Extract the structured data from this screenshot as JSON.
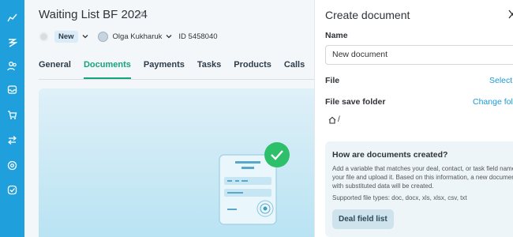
{
  "rail": {
    "icons": [
      "chart-icon",
      "lightning-icon",
      "people-icon",
      "inbox-icon",
      "cart-icon",
      "transfer-icon",
      "settings-circle-icon",
      "check-circle-icon"
    ]
  },
  "deal": {
    "title": "Waiting List BF 2024",
    "status": "New",
    "user": "Olga Kukharuk",
    "id_text": "ID 5458040"
  },
  "tabs": [
    {
      "label": "General",
      "active": false
    },
    {
      "label": "Documents",
      "active": true
    },
    {
      "label": "Payments",
      "active": false
    },
    {
      "label": "Tasks",
      "active": false
    },
    {
      "label": "Products",
      "active": false
    },
    {
      "label": "Calls",
      "active": false
    }
  ],
  "slider": {
    "title": "Create document",
    "name_label": "Name",
    "name_value": "New document",
    "file_label": "File",
    "file_link": "Select",
    "folder_label": "File save folder",
    "folder_link": "Change fol",
    "folder_path": "/",
    "info": {
      "title": "How are documents created?",
      "text": "Add a variable that matches your deal, contact, or task field name to your file and upload it. Based on this information, a new document with substituted data will be created.",
      "types": "Supported file types: doc, docx, xls, xlsx, csv, txt",
      "button": "Deal field list"
    }
  },
  "colors": {
    "rail": "#1fa0dc",
    "accent_green": "#14a37f",
    "link_blue": "#1a9ad6",
    "check_green": "#2ebf6a"
  }
}
